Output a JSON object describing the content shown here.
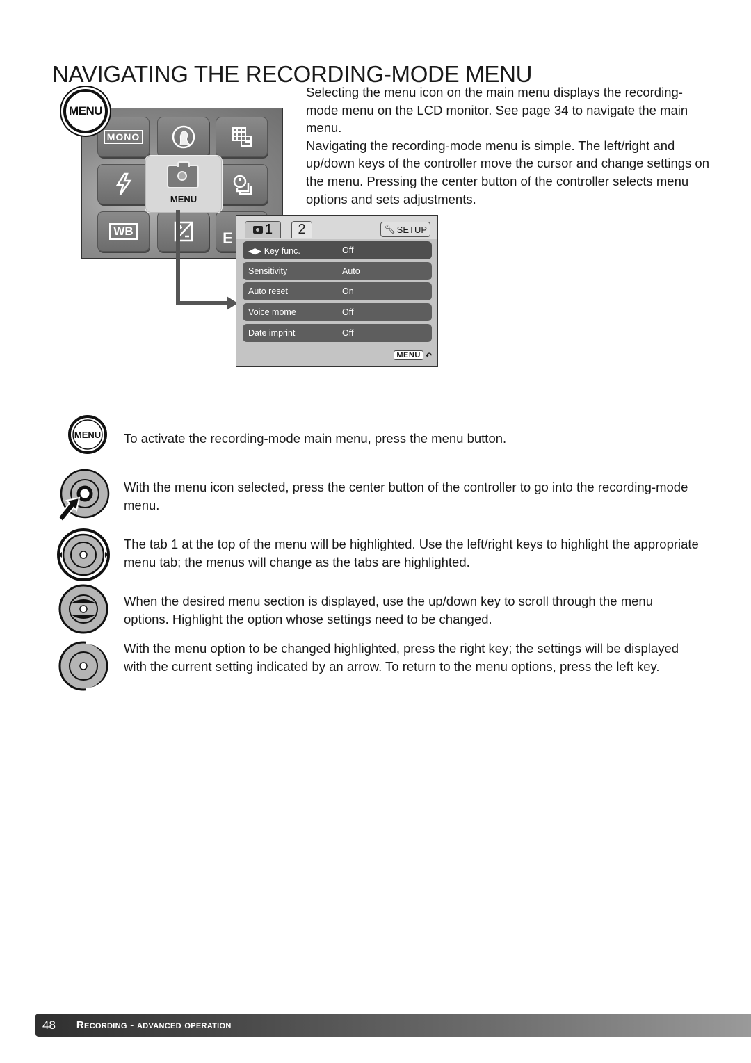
{
  "page": {
    "title": "NAVIGATING THE RECORDING-MODE MENU",
    "intro": [
      "Selecting the menu icon on the main menu displays the recording-mode menu on the LCD monitor. See page 34 to navigate the main menu.",
      "Navigating the recording-mode menu is simple. The left/right and up/down keys of the controller move the cursor and change settings on the menu. Pressing the center button of the controller selects menu options and sets adjustments."
    ]
  },
  "main_menu": {
    "badge": "MENU",
    "tiles": {
      "mono": "MONO",
      "wb": "WB",
      "e": "E"
    },
    "selected_label": "MENU"
  },
  "rec_menu": {
    "tabs": [
      "1",
      "2"
    ],
    "setup": "SETUP",
    "rows": [
      {
        "label": "Key func.",
        "value": "Off"
      },
      {
        "label": "Sensitivity",
        "value": "Auto"
      },
      {
        "label": "Auto reset",
        "value": "On"
      },
      {
        "label": "Voice mome",
        "value": "Off"
      },
      {
        "label": "Date imprint",
        "value": "Off"
      }
    ],
    "back": "MENU"
  },
  "steps": [
    {
      "icon": "menu-button-icon",
      "icon_label": "MENU",
      "text": "To activate the recording-mode main menu, press the menu button."
    },
    {
      "icon": "controller-center-press-icon",
      "text": "With the menu icon selected, press the center button of the controller to go into the recording-mode menu."
    },
    {
      "icon": "controller-left-right-icon",
      "text": "The tab 1 at the top of the menu will be highlighted. Use the left/right keys to highlight the appropriate menu tab; the menus will change as the tabs are highlighted."
    },
    {
      "icon": "controller-up-down-icon",
      "text": "When the desired menu section is displayed, use the up/down key to scroll through the menu options. Highlight the option whose settings need to be changed."
    },
    {
      "icon": "controller-right-icon",
      "text": "With the menu option to be changed highlighted, press the right key; the settings will be displayed with the current setting indicated by an arrow. To return to the menu options, press the left key."
    }
  ],
  "footer": {
    "page_number": "48",
    "section": "Recording - advanced operation"
  }
}
